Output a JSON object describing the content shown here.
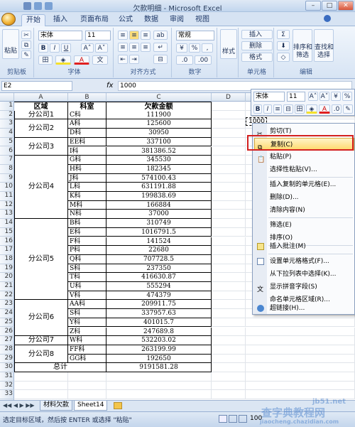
{
  "window": {
    "title": "欠款明细 - Microsoft Excel"
  },
  "tabs": [
    "开始",
    "插入",
    "页面布局",
    "公式",
    "数据",
    "审阅",
    "视图"
  ],
  "ribbon": {
    "paste": "粘贴",
    "font_name": "宋体",
    "font_size": "11",
    "number_format": "常规",
    "style": "样式",
    "insert": "插入",
    "delete": "删除",
    "format": "格式",
    "sort_filter": "排序和\n筛选",
    "find_select": "查找和\n选择",
    "groups": [
      "剪贴板",
      "字体",
      "对齐方式",
      "数字",
      "单元格",
      "编辑"
    ]
  },
  "formula_bar": {
    "name_box": "E2",
    "fx": "fx",
    "value": "1000"
  },
  "columns": [
    "A",
    "B",
    "C",
    "D"
  ],
  "rows": [
    "1",
    "2",
    "3",
    "4",
    "5",
    "6",
    "7",
    "8",
    "9",
    "10",
    "11",
    "12",
    "13",
    "14",
    "15",
    "16",
    "17",
    "18",
    "19",
    "20",
    "21",
    "22",
    "23",
    "24",
    "25",
    "26",
    "27",
    "28",
    "29",
    "30",
    "31",
    "32",
    "33"
  ],
  "table": {
    "headers": [
      "区域",
      "科室",
      "欠款金额"
    ],
    "groups": [
      "分公司1",
      "分公司2",
      "分公司3",
      "分公司4",
      "分公司5",
      "分公司6",
      "分公司7",
      "分公司8",
      "总计"
    ],
    "depts": [
      "C科",
      "A科",
      "D科",
      "EE科",
      "I科",
      "G科",
      "H科",
      "J科",
      "L科",
      "K科",
      "M科",
      "N科",
      "B科",
      "E科",
      "F科",
      "P科",
      "Q科",
      "S科",
      "T科",
      "U科",
      "V科",
      "AA科",
      "S科",
      "Y科",
      "Z科",
      "W科",
      "FF科",
      "GG科"
    ],
    "amounts": [
      "111900",
      "125600",
      "30950",
      "337100",
      "381386.52",
      "345530",
      "182345",
      "574100.43",
      "631191.88",
      "199838.69",
      "166884",
      "37000",
      "310749",
      "1016791.5",
      "141524",
      "22680",
      "707728.5",
      "237350",
      "416630.87",
      "555294",
      "474379",
      "209911.75",
      "337957.63",
      "401015.7",
      "247689.8",
      "532203.02",
      "263199.99",
      "192650",
      "9191581.28"
    ]
  },
  "selected_cell_value": "1000",
  "mini_toolbar": {
    "font": "宋体",
    "size": "11"
  },
  "context_menu": [
    "剪切(T)",
    "复制(C)",
    "粘贴(P)",
    "选择性粘贴(V)...",
    "插入复制的单元格(E)...",
    "删除(D)...",
    "清除内容(N)",
    "筛选(E)",
    "排序(O)",
    "插入批注(M)",
    "设置单元格格式(F)...",
    "从下拉列表中选择(K)...",
    "显示拼音字段(S)",
    "命名单元格区域(R)...",
    "超链接(H)..."
  ],
  "sheets": [
    "材料欠款",
    "Sheet14"
  ],
  "status_text": "选定目标区域，然后按 ENTER 或选择 \"粘贴\"",
  "zoom_partial": "100",
  "watermark": [
    "查字典",
    "教程网",
    "jb51.net",
    "jiaocheng.chazidian.com"
  ]
}
